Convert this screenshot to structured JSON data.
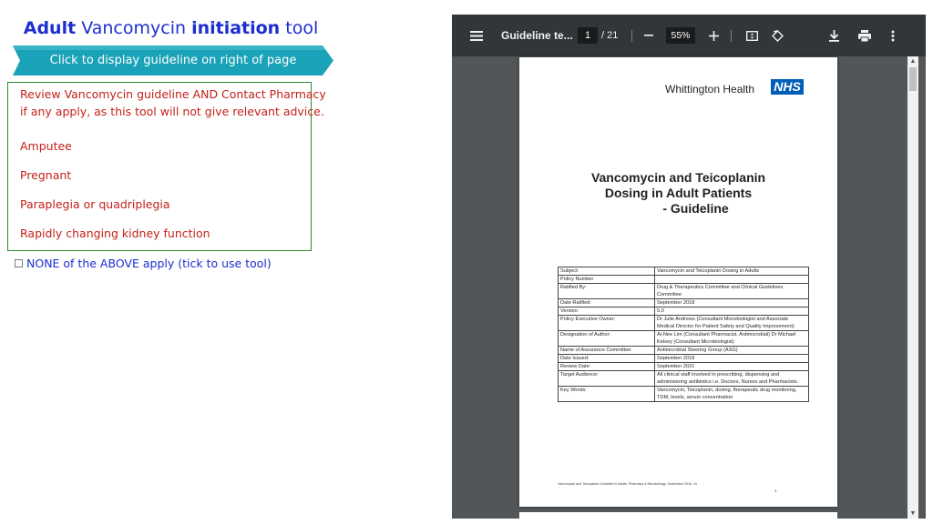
{
  "tool": {
    "title_word1": "Adult",
    "title_word2": " Vancomycin ",
    "title_word3": "initiation",
    "title_word4": " tool",
    "banner_label": "Click to display guideline on right of page",
    "warning_line1": "Review Vancomycin guideline AND Contact Pharmacy",
    "warning_line2": "if any apply, as this tool will not give relevant advice.",
    "conditions": [
      "Amputee",
      "Pregnant",
      "Paraplegia or quadriplegia",
      "Rapidly changing kidney function"
    ],
    "none_label": "NONE of the ABOVE apply (tick to use tool)",
    "none_checked": false
  },
  "viewer": {
    "doc_title": "Guideline te...",
    "page_current": "1",
    "page_total": "/ 21",
    "zoom": "55%"
  },
  "pdf": {
    "organisation": "Whittington Health",
    "nhs_logo": "NHS",
    "heading_line1": "Vancomycin and Teicoplanin",
    "heading_line2": "Dosing in Adult Patients",
    "heading_line3": "- Guideline",
    "table": [
      {
        "label": "Subject:",
        "value": "Vancomycin and Teicoplanin Dosing in Adults"
      },
      {
        "label": "Policy Number",
        "value": ""
      },
      {
        "label": "Ratified By:",
        "value": "Drug & Therapeutics Committee and Clinical Guidelines Committee"
      },
      {
        "label": "Date Ratified:",
        "value": "September 2018"
      },
      {
        "label": "Version:",
        "value": "5.0"
      },
      {
        "label": "Policy Executive Owner:",
        "value": "Dr Julie Andrews (Consultant Microbiologist and Associate Medical Director for Patient Safety and Quality Improvement)"
      },
      {
        "label": "Designation of Author:",
        "value": "Ai-Nee Lim (Consultant Pharmacist, Antimicrobial) Dr Michael Kelsey (Consultant Microbiologist)"
      },
      {
        "label": "Name of Assurance Committee:",
        "value": "Antimicrobial Steering Group (ASG)"
      },
      {
        "label": "Date Issued:",
        "value": "September 2018"
      },
      {
        "label": "Review Date:",
        "value": "September 2021"
      },
      {
        "label": "Target Audience:",
        "value": "All clinical staff involved in prescribing, dispensing and administering antibiotics i.e. Doctors, Nurses and Pharmacists."
      },
      {
        "label": "Key Words:",
        "value": "Vancomycin, Teicoplanin, dosing, therapeutic drug monitoring, TDM, levels, serum concentration"
      }
    ],
    "footer": "Vancomycin and Teicoplanin Guideline in Adults. Pharmacy & Microbiology. September 2018. v5",
    "page_number": "1"
  },
  "colors": {
    "title_blue": "#1b2ed1",
    "banner_teal": "#1aa2b8",
    "warning_red": "#c4211b",
    "box_green": "#2d8a2d",
    "nhs_blue": "#005eb8",
    "toolbar_bg": "#323639"
  },
  "icons": {
    "menu": "hamburger-menu-icon",
    "zoom_out": "minus-icon",
    "zoom_in": "plus-icon",
    "fit": "fit-to-page-icon",
    "rotate": "rotate-icon",
    "download": "download-icon",
    "print": "print-icon",
    "more": "more-vert-icon"
  }
}
